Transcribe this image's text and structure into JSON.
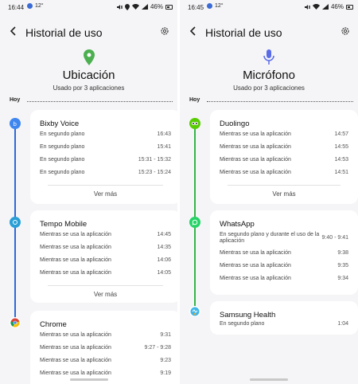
{
  "colors": {
    "location_green": "#4caf50",
    "mic_blue": "#5a6be8",
    "timeline_blue": "#2b6bd8",
    "background": "#f5f5f7"
  },
  "left": {
    "status": {
      "time": "16:44",
      "temp": "12°",
      "battery": "46%"
    },
    "title": "Historial de uso",
    "hero": {
      "icon": "location-pin-icon",
      "title": "Ubicación",
      "subtitle": "Usado por 3 aplicaciones"
    },
    "day": "Hoy",
    "apps": [
      {
        "name": "Bixby Voice",
        "icon": "bixby-icon",
        "rows": [
          {
            "label": "En segundo plano",
            "time": "16:43"
          },
          {
            "label": "En segundo plano",
            "time": "15:41"
          },
          {
            "label": "En segundo plano",
            "time": "15:31 - 15:32"
          },
          {
            "label": "En segundo plano",
            "time": "15:23 - 15:24"
          }
        ],
        "more": "Ver más"
      },
      {
        "name": "Tempo Mobile",
        "icon": "tempo-icon",
        "rows": [
          {
            "label": "Mientras se usa la aplicación",
            "time": "14:45"
          },
          {
            "label": "Mientras se usa la aplicación",
            "time": "14:35"
          },
          {
            "label": "Mientras se usa la aplicación",
            "time": "14:06"
          },
          {
            "label": "Mientras se usa la aplicación",
            "time": "14:05"
          }
        ],
        "more": "Ver más"
      },
      {
        "name": "Chrome",
        "icon": "chrome-icon",
        "rows": [
          {
            "label": "Mientras se usa la aplicación",
            "time": "9:31"
          },
          {
            "label": "Mientras se usa la aplicación",
            "time": "9:27 - 9:28"
          },
          {
            "label": "Mientras se usa la aplicación",
            "time": "9:23"
          },
          {
            "label": "Mientras se usa la aplicación",
            "time": "9:19"
          }
        ]
      }
    ]
  },
  "right": {
    "status": {
      "time": "16:45",
      "temp": "12°",
      "battery": "46%"
    },
    "title": "Historial de uso",
    "hero": {
      "icon": "microphone-icon",
      "title": "Micrófono",
      "subtitle": "Usado por 3 aplicaciones"
    },
    "day": "Hoy",
    "apps": [
      {
        "name": "Duolingo",
        "icon": "duolingo-icon",
        "rows": [
          {
            "label": "Mientras se usa la aplicación",
            "time": "14:57"
          },
          {
            "label": "Mientras se usa la aplicación",
            "time": "14:55"
          },
          {
            "label": "Mientras se usa la aplicación",
            "time": "14:53"
          },
          {
            "label": "Mientras se usa la aplicación",
            "time": "14:51"
          }
        ],
        "more": "Ver más"
      },
      {
        "name": "WhatsApp",
        "icon": "whatsapp-icon",
        "rows": [
          {
            "label": "En segundo plano y durante el uso de la aplicación",
            "time": "9:40 - 9:41"
          },
          {
            "label": "Mientras se usa la aplicación",
            "time": "9:38"
          },
          {
            "label": "Mientras se usa la aplicación",
            "time": "9:35"
          },
          {
            "label": "Mientras se usa la aplicación",
            "time": "9:34"
          }
        ]
      },
      {
        "name": "Samsung Health",
        "icon": "samsung-health-icon",
        "rows": [
          {
            "label": "En segundo plano",
            "time": "1:04"
          }
        ]
      }
    ]
  }
}
